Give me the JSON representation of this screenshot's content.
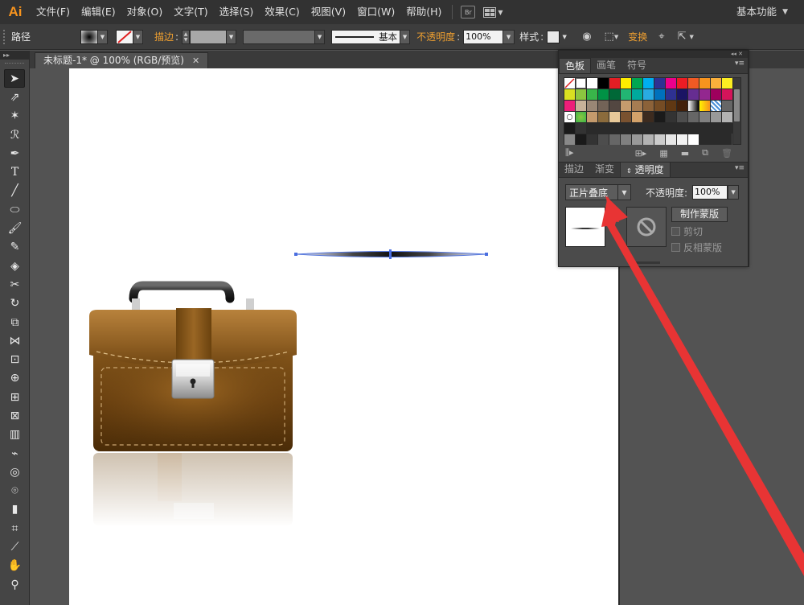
{
  "app": {
    "logo": "Ai",
    "workspace": "基本功能"
  },
  "menu": {
    "items": [
      "文件(F)",
      "编辑(E)",
      "对象(O)",
      "文字(T)",
      "选择(S)",
      "效果(C)",
      "视图(V)",
      "窗口(W)",
      "帮助(H)"
    ],
    "bridge": "Br"
  },
  "controlbar": {
    "object_type": "路径",
    "stroke_label": "描边",
    "stroke_profile": "基本",
    "opacity_label": "不透明度",
    "opacity_value": "100%",
    "style_label": "样式",
    "transform_label": "变换"
  },
  "document": {
    "tab_title": "未标题-1* @ 100% (RGB/预览)"
  },
  "swatches_panel": {
    "tabs": [
      "色板",
      "画笔",
      "符号"
    ]
  },
  "transparency_panel": {
    "tabs": [
      "描边",
      "渐变",
      "透明度"
    ],
    "blend_mode": "正片叠底",
    "opacity_label": "不透明度:",
    "opacity_value": "100%",
    "make_mask": "制作蒙版",
    "clip": "剪切",
    "invert_mask": "反相蒙版"
  },
  "colors": {
    "accent_orange": "#f0a030",
    "arrow_red": "#e83434"
  }
}
